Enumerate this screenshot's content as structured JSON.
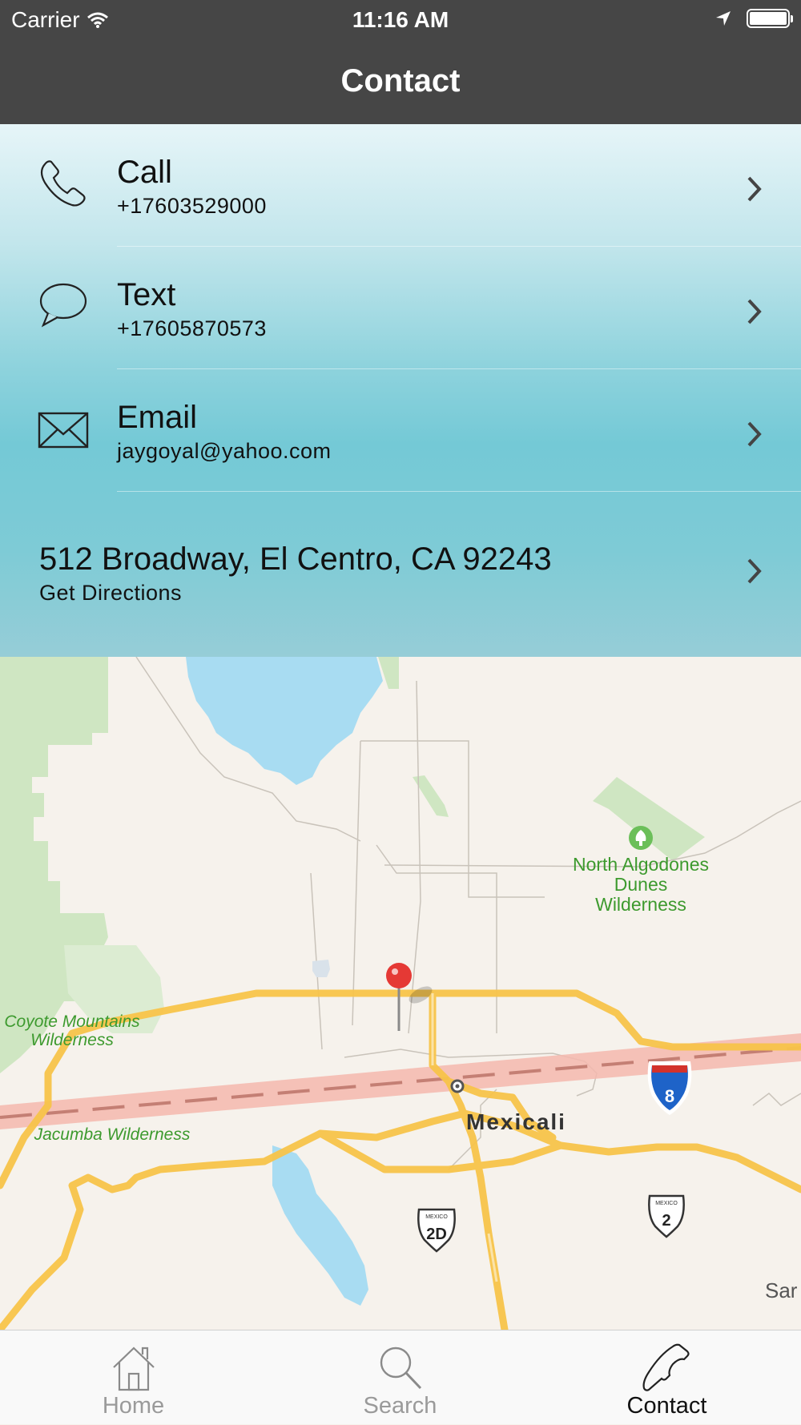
{
  "status_bar": {
    "carrier": "Carrier",
    "time": "11:16 AM",
    "icons": [
      "wifi-icon",
      "location-arrow-icon",
      "battery-icon"
    ]
  },
  "nav": {
    "title": "Contact"
  },
  "contacts": {
    "call": {
      "label": "Call",
      "value": "+17603529000",
      "icon": "phone-icon"
    },
    "text": {
      "label": "Text",
      "value": "+17605870573",
      "icon": "chat-bubble-icon"
    },
    "email": {
      "label": "Email",
      "value": "jaygoyal@yahoo.com",
      "icon": "envelope-icon"
    },
    "address": {
      "label": "512 Broadway, El Centro, CA 92243",
      "action": "Get Directions"
    }
  },
  "map": {
    "labels": {
      "north_algodones": [
        "North Algodones",
        "Dunes",
        "Wilderness"
      ],
      "coyote": [
        "Coyote Mountains",
        "Wilderness"
      ],
      "jacumba": "Jacumba Wilderness",
      "city": "Mexicali",
      "edge": "Sar"
    },
    "shields": {
      "interstate": "8",
      "mexico_2d": "2D",
      "mexico_2": "2",
      "mexico_small": "MEXICO"
    },
    "colors": {
      "land": "#f6f2ec",
      "water": "#a8dcf2",
      "park": "#cfe6c2",
      "highway": "#f8c44a",
      "border": "#f4b8ae",
      "pin": "#e53935"
    }
  },
  "tabs": [
    {
      "label": "Home",
      "icon": "home-icon",
      "active": false
    },
    {
      "label": "Search",
      "icon": "search-icon",
      "active": false
    },
    {
      "label": "Contact",
      "icon": "phone-icon",
      "active": true
    }
  ]
}
